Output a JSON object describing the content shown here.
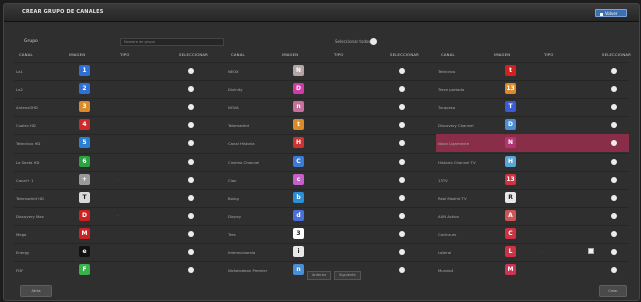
{
  "header": {
    "title": "CREAR GRUPO DE CANALES",
    "back_label": "Volver"
  },
  "form": {
    "group_label": "Grupo",
    "group_placeholder": "Nombre de grupo",
    "select_all_label": "Seleccionar todos"
  },
  "columns": {
    "canal": "CANAL",
    "imagen": "IMAGEN",
    "tipo": "TIPO",
    "seleccionar": "SELECCIONAR"
  },
  "table": {
    "col1": [
      {
        "name": "La1",
        "color": "#2f6fd6",
        "glyph": "1",
        "dash": false
      },
      {
        "name": "La2",
        "color": "#2f6fd6",
        "glyph": "2",
        "dash": false
      },
      {
        "name": "Antena3HD",
        "color": "#d98a2a",
        "glyph": "3",
        "dash": false
      },
      {
        "name": "Cuatro HD",
        "color": "#cf2a2a",
        "glyph": "4",
        "dash": false
      },
      {
        "name": "Telecinco HD",
        "color": "#2a7fd6",
        "glyph": "5",
        "dash": false
      },
      {
        "name": "La Sexta HD",
        "color": "#2aa340",
        "glyph": "6",
        "dash": false
      },
      {
        "name": "Canal+ 1",
        "color": "#9a9a9a",
        "glyph": "+",
        "dash": true
      },
      {
        "name": "Telemadrid HD",
        "color": "#d9d9d9",
        "glyph": "T",
        "dash": false
      },
      {
        "name": "Discovery Max",
        "color": "#cc2222",
        "glyph": "D",
        "dash": true
      },
      {
        "name": "Mega",
        "color": "#cc2222",
        "glyph": "M",
        "dash": false
      },
      {
        "name": "Energy",
        "color": "#111111",
        "glyph": "e",
        "dash": false
      },
      {
        "name": "FDF",
        "color": "#39b34a",
        "glyph": "F",
        "dash": false
      }
    ],
    "col2": [
      {
        "name": "NEOX",
        "color": "#b5a6a6",
        "glyph": "N",
        "dash": false
      },
      {
        "name": "Divinity",
        "color": "#d23aa6",
        "glyph": "D",
        "dash": false
      },
      {
        "name": "NOVA",
        "color": "#c8709a",
        "glyph": "n",
        "dash": false
      },
      {
        "name": "Telemadrid",
        "color": "#d98a2a",
        "glyph": "t",
        "dash": false
      },
      {
        "name": "Canal Historia",
        "color": "#cc3333",
        "glyph": "H",
        "dash": false
      },
      {
        "name": "Cinemo Channel",
        "color": "#3b7bd6",
        "glyph": "C",
        "dash": false
      },
      {
        "name": "Clan",
        "color": "#c460c8",
        "glyph": "c",
        "dash": false
      },
      {
        "name": "Boing",
        "color": "#2a8fd6",
        "glyph": "b",
        "dash": false
      },
      {
        "name": "Disney",
        "color": "#4a6fd6",
        "glyph": "d",
        "dash": false
      },
      {
        "name": "Tres",
        "color": "#ffffff",
        "glyph": "3",
        "dash": false
      },
      {
        "name": "Intereconomía",
        "color": "#e8e8e8",
        "glyph": "i",
        "dash": false
      },
      {
        "name": "Nickelodeon Premier",
        "color": "#4a8fd6",
        "glyph": "n",
        "dash": false
      }
    ],
    "col3": [
      {
        "name": "Telecinco",
        "color": "#cc2222",
        "glyph": "t",
        "dash": false,
        "highlight": false,
        "check": false
      },
      {
        "name": "Trece portada",
        "color": "#d98a2a",
        "glyph": "13",
        "dash": false,
        "highlight": false,
        "check": false
      },
      {
        "name": "Turquesa",
        "color": "#3b5bd6",
        "glyph": "T",
        "dash": false,
        "highlight": false,
        "check": false
      },
      {
        "name": "Discovery Channel",
        "color": "#4a8fd6",
        "glyph": "D",
        "dash": false,
        "highlight": false,
        "check": false
      },
      {
        "name": "Nova Ligamente",
        "color": "#b03570",
        "glyph": "N",
        "dash": true,
        "highlight": true,
        "check": false
      },
      {
        "name": "Historia Channel TV",
        "color": "#5aa5d6",
        "glyph": "H",
        "dash": false,
        "highlight": false,
        "check": false
      },
      {
        "name": "13TV",
        "color": "#cc3344",
        "glyph": "13",
        "dash": false,
        "highlight": false,
        "check": false
      },
      {
        "name": "Real Madrid TV",
        "color": "#e8e8e8",
        "glyph": "R",
        "dash": false,
        "highlight": false,
        "check": false
      },
      {
        "name": "AXN Action",
        "color": "#cc5555",
        "glyph": "A",
        "dash": false,
        "highlight": false,
        "check": false
      },
      {
        "name": "Cocina.es",
        "color": "#cc3344",
        "glyph": "C",
        "dash": false,
        "highlight": false,
        "check": false
      },
      {
        "name": "Lateral",
        "color": "#cc3344",
        "glyph": "L",
        "dash": true,
        "highlight": false,
        "check": true
      },
      {
        "name": "Mundo4",
        "color": "#cc3355",
        "glyph": "M",
        "dash": false,
        "highlight": false,
        "check": false
      }
    ]
  },
  "pager": {
    "prev": "Anterior",
    "next": "Siguiente"
  },
  "footer": {
    "left_label": "Atrás",
    "right_label": "Crear"
  }
}
